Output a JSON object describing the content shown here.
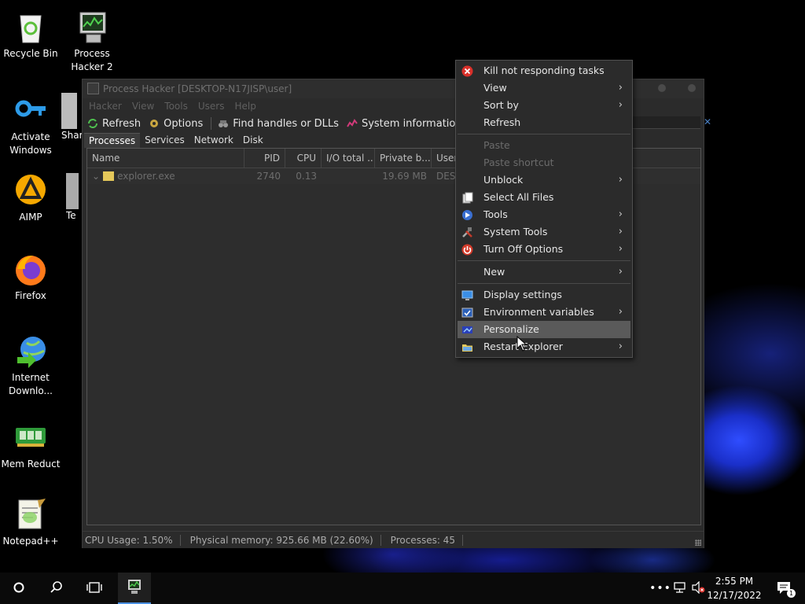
{
  "desktop": {
    "icons": [
      {
        "label": "Recycle Bin"
      },
      {
        "label": "Process Hacker 2"
      },
      {
        "label": "Activate Windows"
      },
      {
        "label": "Shar"
      },
      {
        "label": "AIMP"
      },
      {
        "label": "Te"
      },
      {
        "label": "Firefox"
      },
      {
        "label": "Internet Downlo..."
      },
      {
        "label": "Mem Reduct"
      },
      {
        "label": "Notepad++"
      }
    ]
  },
  "window": {
    "title": "Process Hacker [DESKTOP-N17JISP\\user]",
    "menu": [
      "Hacker",
      "View",
      "Tools",
      "Users",
      "Help"
    ],
    "toolbar": {
      "refresh": "Refresh",
      "options": "Options",
      "find_handles": "Find handles or DLLs",
      "system_information": "System information"
    },
    "tabs": [
      "Processes",
      "Services",
      "Network",
      "Disk"
    ],
    "columns": [
      "Name",
      "PID",
      "CPU",
      "I/O total ...",
      "Private b...",
      "User"
    ],
    "rows": [
      {
        "name": "explorer.exe",
        "pid": "2740",
        "cpu": "0.13",
        "io": "",
        "private": "19.69 MB",
        "user": "DESK"
      }
    ],
    "status": {
      "cpu": "CPU Usage: 1.50%",
      "memory": "Physical memory: 925.66 MB (22.60%)",
      "processes": "Processes: 45"
    }
  },
  "context_menu": {
    "items": [
      {
        "label": "Kill not responding tasks",
        "icon": "kill-icon",
        "submenu": false
      },
      {
        "label": "View",
        "submenu": true
      },
      {
        "label": "Sort by",
        "submenu": true
      },
      {
        "label": "Refresh",
        "submenu": false
      },
      {
        "label": "Paste",
        "disabled": true
      },
      {
        "label": "Paste shortcut",
        "disabled": true
      },
      {
        "label": "Unblock",
        "submenu": true
      },
      {
        "label": "Select All Files",
        "icon": "select-all-icon"
      },
      {
        "label": "Tools",
        "icon": "tools-arrow-icon",
        "submenu": true
      },
      {
        "label": "System Tools",
        "icon": "system-tools-icon",
        "submenu": true
      },
      {
        "label": "Turn Off Options",
        "icon": "power-icon",
        "submenu": true
      },
      {
        "label": "New",
        "submenu": true
      },
      {
        "label": "Display settings",
        "icon": "display-icon"
      },
      {
        "label": "Environment variables",
        "icon": "environment-icon",
        "submenu": true
      },
      {
        "label": "Personalize",
        "icon": "personalize-icon",
        "highlighted": true
      },
      {
        "label": "Restart Explorer",
        "icon": "folder-icon",
        "submenu": true
      }
    ]
  },
  "taskbar": {
    "time": "2:55 PM",
    "date": "12/17/2022",
    "notification_count": "1"
  },
  "colors": {
    "menu_bg": "#2b2b2b",
    "highlight": "#5a5a5a",
    "wallpaper_accent": "#2f4dff"
  }
}
